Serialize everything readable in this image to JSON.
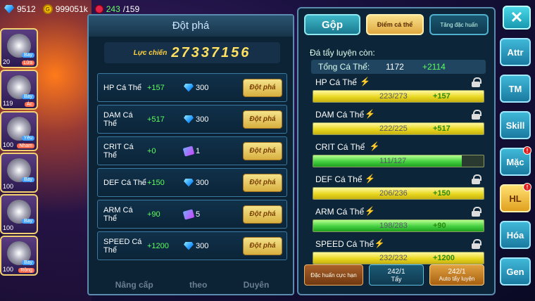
{
  "top": {
    "gems": "9512",
    "gold": "999051k",
    "stamina": "243",
    "stamina_max": "/159"
  },
  "party": [
    {
      "level": "20",
      "tag1": "Bay",
      "tag2": "Lửa"
    },
    {
      "level": "119",
      "tag1": "Bay",
      "tag2": "Ác"
    },
    {
      "level": "100",
      "tag1": "Yêu",
      "tag2": "Nham"
    },
    {
      "level": "100",
      "tag1": "Bay",
      "tag2": ""
    },
    {
      "level": "100",
      "tag1": "Bay",
      "tag2": ""
    },
    {
      "level": "100",
      "tag1": "Bay",
      "tag2": "Rồng"
    }
  ],
  "breakthrough": {
    "title": "Đột phá",
    "power_label": "Lực chiến",
    "power_value": "27337156",
    "rows": [
      {
        "name": "HP Cá Thể",
        "bonus": "+157",
        "cost": "300",
        "icon": "diamond-icon",
        "button": "Đột phá"
      },
      {
        "name": "DAM Cá Thể",
        "bonus": "+517",
        "cost": "300",
        "icon": "diamond-icon",
        "button": "Đột phá"
      },
      {
        "name": "CRIT Cá Thể",
        "bonus": "+0",
        "cost": "1",
        "icon": "scroll-icon",
        "button": "Đột phá"
      },
      {
        "name": "DEF Cá Thể",
        "bonus": "+150",
        "cost": "300",
        "icon": "diamond-icon",
        "button": "Đột phá"
      },
      {
        "name": "ARM Cá Thể",
        "bonus": "+90",
        "cost": "5",
        "icon": "scroll-icon",
        "button": "Đột phá"
      },
      {
        "name": "SPEED Cá Thể",
        "bonus": "+1200",
        "cost": "300",
        "icon": "diamond-icon",
        "button": "Đột phá"
      }
    ],
    "bottom_tabs": [
      "Nâng cấp",
      "theo",
      "Duyên"
    ]
  },
  "training": {
    "tabs": {
      "gop": "Gộp",
      "diem": "Điểm cá thể",
      "tang": "Tăng đặc huấn"
    },
    "remaining_label": "Đá tẩy luyện còn:",
    "total_label": "Tổng Cá Thể:",
    "total_value": "1172",
    "total_add": "+2114",
    "stats": [
      {
        "name": "HP Cá Thể",
        "current": "223/273",
        "add": "+157",
        "fill": 1.0,
        "color": "yellow"
      },
      {
        "name": "DAM Cá Thể",
        "current": "222/225",
        "add": "+517",
        "fill": 1.0,
        "color": "yellow"
      },
      {
        "name": "CRIT Cá Thể",
        "current": "111/127",
        "add": "",
        "fill": 0.87,
        "color": "green"
      },
      {
        "name": "DEF Cá Thể",
        "current": "206/236",
        "add": "+150",
        "fill": 1.0,
        "color": "yellow"
      },
      {
        "name": "ARM Cá Thể",
        "current": "198/283",
        "add": "+90",
        "fill": 1.0,
        "color": "green"
      },
      {
        "name": "SPEED Cá Thể",
        "current": "232/232",
        "add": "+1200",
        "fill": 1.0,
        "color": "yellow"
      }
    ],
    "buttons": {
      "dac_huan": "Đặc huấn cực hạn",
      "tay_count": "242/1",
      "tay_label": "Tẩy",
      "auto_count": "242/1",
      "auto_label": "Auto tẩy luyện"
    }
  },
  "side_menu": [
    {
      "label": "Attr",
      "badge": false
    },
    {
      "label": "TM",
      "badge": false
    },
    {
      "label": "Skill",
      "badge": false
    },
    {
      "label": "Mặc",
      "badge": true
    },
    {
      "label": "HL",
      "badge": true,
      "active": true
    },
    {
      "label": "Hóa",
      "badge": false
    },
    {
      "label": "Gen",
      "badge": false
    }
  ]
}
